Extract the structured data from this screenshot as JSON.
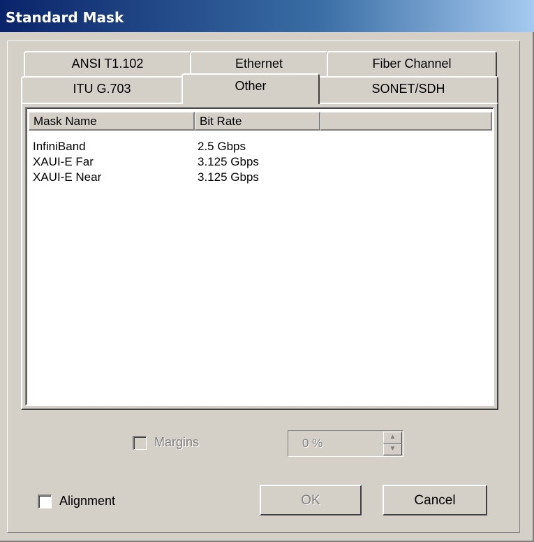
{
  "window": {
    "title": "Standard Mask"
  },
  "tabs": {
    "back_row": [
      "ANSI T1.102",
      "Ethernet",
      "Fiber Channel"
    ],
    "front_row": [
      "ITU G.703",
      "Other",
      "SONET/SDH"
    ],
    "active": "Other"
  },
  "list": {
    "columns": [
      "Mask Name",
      "Bit Rate",
      ""
    ],
    "rows": [
      {
        "name": "InfiniBand",
        "rate": "2.5 Gbps"
      },
      {
        "name": "XAUI-E Far",
        "rate": "3.125 Gbps"
      },
      {
        "name": "XAUI-E Near",
        "rate": "3.125 Gbps"
      }
    ]
  },
  "options": {
    "margins_label": "Margins",
    "margins_value": "0 %",
    "alignment_label": "Alignment"
  },
  "buttons": {
    "ok": "OK",
    "cancel": "Cancel"
  }
}
